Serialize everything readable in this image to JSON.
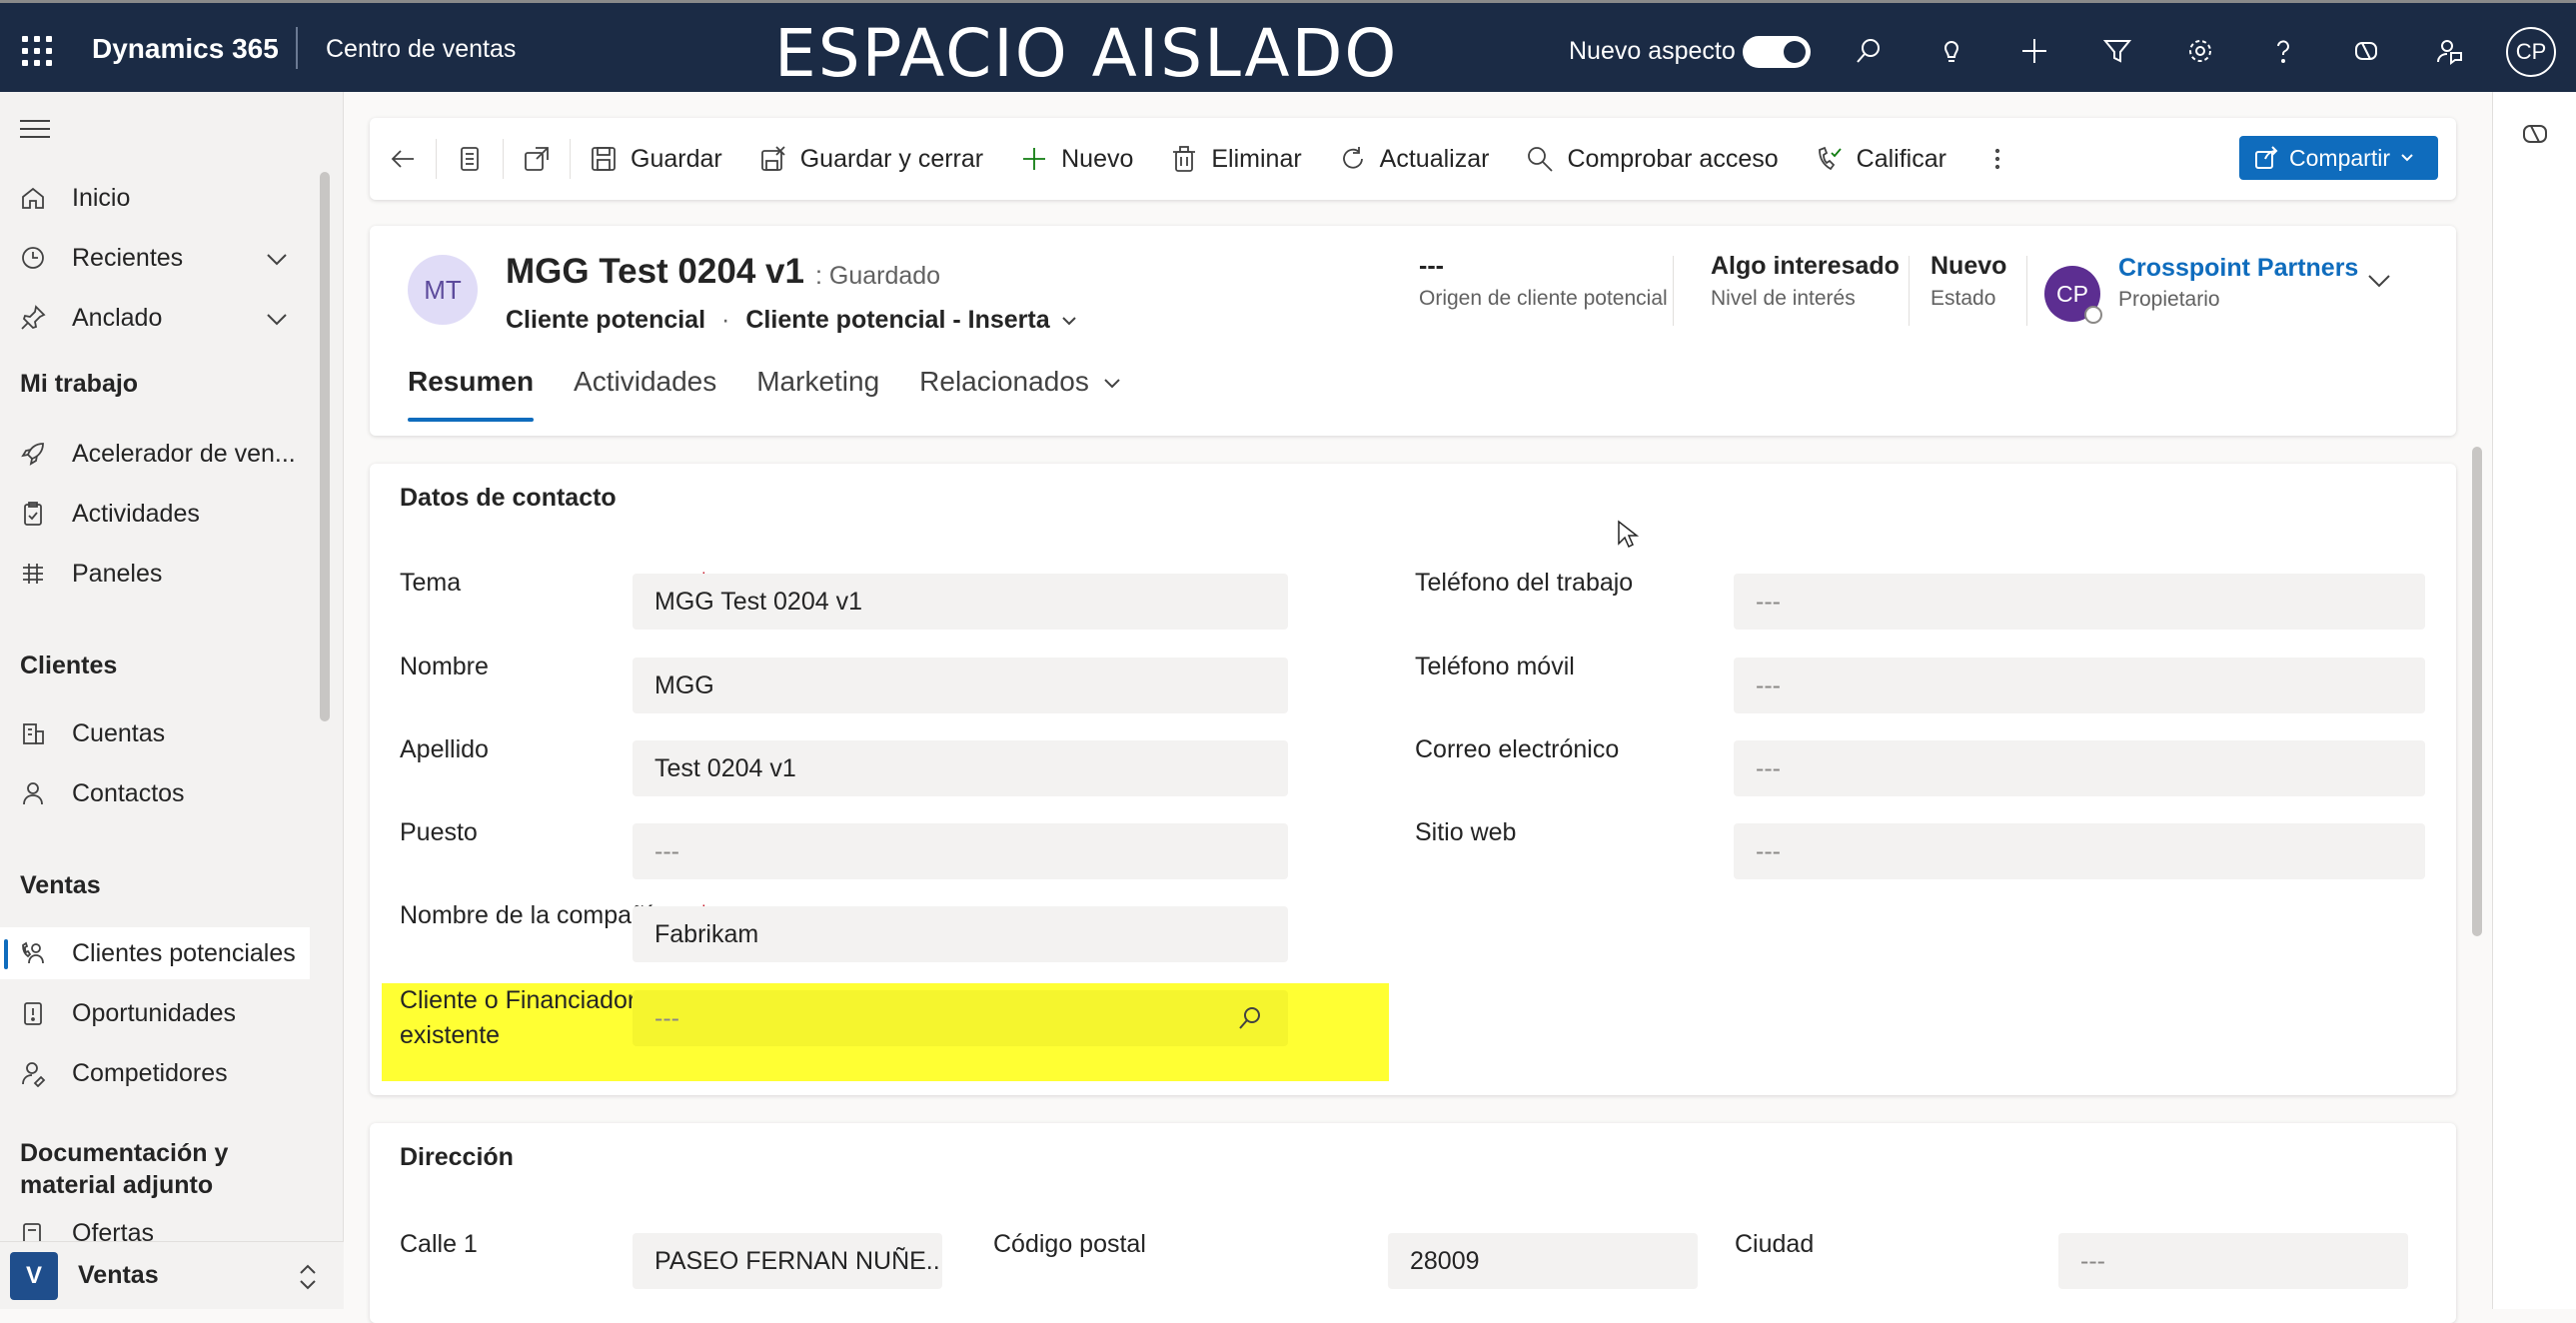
{
  "topbar": {
    "brand": "Dynamics 365",
    "app_name": "Centro de ventas",
    "environment_label": "ESPACIO AISLADO",
    "new_look_label": "Nuevo aspecto",
    "new_look_on": true,
    "user_initials": "CP",
    "icons": [
      "search-icon",
      "lightbulb-icon",
      "plus-icon",
      "filter-icon",
      "gear-icon",
      "help-icon",
      "copilot-icon",
      "feedback-icon"
    ]
  },
  "nav": {
    "items": [
      {
        "label": "Inicio",
        "icon": "home-icon"
      },
      {
        "label": "Recientes",
        "icon": "clock-icon",
        "expandable": true
      },
      {
        "label": "Anclado",
        "icon": "pin-icon",
        "expandable": true
      }
    ],
    "groups": [
      {
        "title": "Mi trabajo",
        "items": [
          {
            "label": "Acelerador de ven...",
            "icon": "rocket-icon"
          },
          {
            "label": "Actividades",
            "icon": "clipboard-icon"
          },
          {
            "label": "Paneles",
            "icon": "dashboard-icon"
          }
        ]
      },
      {
        "title": "Clientes",
        "items": [
          {
            "label": "Cuentas",
            "icon": "building-icon"
          },
          {
            "label": "Contactos",
            "icon": "person-icon"
          }
        ]
      },
      {
        "title": "Ventas",
        "items": [
          {
            "label": "Clientes potenciales",
            "icon": "phone-person-icon",
            "active": true
          },
          {
            "label": "Oportunidades",
            "icon": "opportunity-icon"
          },
          {
            "label": "Competidores",
            "icon": "competitor-icon"
          }
        ]
      },
      {
        "title": "Documentación y material adjunto",
        "items": [
          {
            "label": "Ofertas",
            "icon": "quote-icon"
          }
        ]
      }
    ],
    "area": {
      "badge": "V",
      "label": "Ventas"
    }
  },
  "commands": {
    "save": "Guardar",
    "save_close": "Guardar y cerrar",
    "new": "Nuevo",
    "delete": "Eliminar",
    "refresh": "Actualizar",
    "check_access": "Comprobar acceso",
    "qualify": "Calificar",
    "share": "Compartir"
  },
  "record": {
    "initials": "MT",
    "title": "MGG Test 0204 v1",
    "status": ": Guardado",
    "entity": "Cliente potencial",
    "form": "Cliente potencial - Inserta",
    "header_fields": [
      {
        "value": "---",
        "label": "Origen de cliente potencial"
      },
      {
        "value": "Algo interesado",
        "label": "Nivel de interés"
      },
      {
        "value": "Nuevo",
        "label": "Estado"
      }
    ],
    "owner": {
      "initials": "CP",
      "name": "Crosspoint Partners",
      "label": "Propietario"
    }
  },
  "tabs": [
    "Resumen",
    "Actividades",
    "Marketing",
    "Relacionados"
  ],
  "contact_section": {
    "title": "Datos de contacto",
    "left": [
      {
        "label": "Tema",
        "value": "MGG Test 0204 v1",
        "required": true
      },
      {
        "label": "Nombre",
        "value": "MGG"
      },
      {
        "label": "Apellido",
        "value": "Test 0204 v1"
      },
      {
        "label": "Puesto",
        "value": "---"
      },
      {
        "label": "Nombre de la compañía",
        "value": "Fabrikam",
        "required": true
      },
      {
        "label_line1": "Cliente o Financiador",
        "label_line2": "existente",
        "value": "---"
      }
    ],
    "right": [
      {
        "label": "Teléfono del trabajo",
        "value": "---"
      },
      {
        "label": "Teléfono móvil",
        "value": "---"
      },
      {
        "label": "Correo electrónico",
        "value": "---"
      },
      {
        "label": "Sitio web",
        "value": "---"
      }
    ]
  },
  "address_section": {
    "title": "Dirección",
    "fields": [
      {
        "label": "Calle 1",
        "value": "PASEO FERNAN NUÑE..."
      },
      {
        "label": "Código postal",
        "value": "28009"
      },
      {
        "label": "Ciudad",
        "value": "---"
      }
    ]
  },
  "colors": {
    "topbar": "#1b2b45",
    "accent": "#0f6cbd",
    "highlight": "#ffff33",
    "owner_avatar": "#5c2e91"
  }
}
